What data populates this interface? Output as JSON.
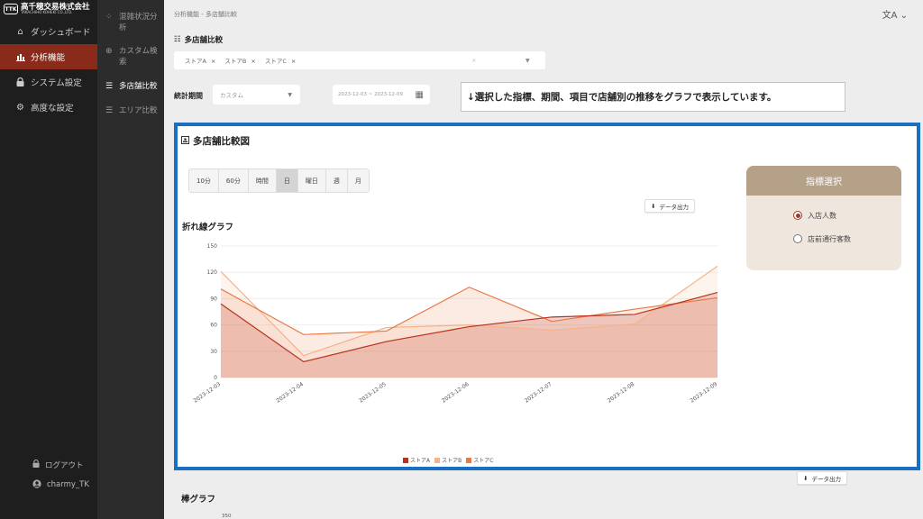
{
  "brand": {
    "logo_text": "TTK",
    "name": "高千穂交易株式会社",
    "sub": "TAKACHIHO KOHEKI CO.,LTD."
  },
  "sidebar": {
    "items": [
      {
        "label": "ダッシュボード",
        "icon": "home-icon"
      },
      {
        "label": "分析機能",
        "icon": "bar-chart-icon",
        "active": true
      },
      {
        "label": "システム設定",
        "icon": "lock-icon"
      },
      {
        "label": "高度な設定",
        "icon": "settings-icon"
      }
    ],
    "logout_label": "ログアウト",
    "user_label": "charmy_TK"
  },
  "subnav": {
    "items": [
      {
        "label": "混雑状況分析",
        "icon": "dots-icon"
      },
      {
        "label": "カスタム検索",
        "icon": "custom-search-icon"
      },
      {
        "label": "多店舗比較",
        "icon": "database-icon",
        "active": true
      },
      {
        "label": "エリア比較",
        "icon": "database-icon"
      }
    ]
  },
  "header": {
    "breadcrumb": "分析機能 - 多店舗比較",
    "language_icon": "translate-icon"
  },
  "filters": {
    "section_title": "多店舗比較",
    "stores": [
      "ストアA",
      "ストアB",
      "ストアC"
    ],
    "chip_remove": "×",
    "clear_all": "×",
    "period_label": "統計期間",
    "period_value": "カスタム",
    "date_range": "2023-12-03 ~ 2023-12-09"
  },
  "callout": "↓選択した指標、期間、項目で店舗別の推移をグラフで表示しています。",
  "card": {
    "title": "多店舗比較図",
    "granularity": [
      "10分",
      "60分",
      "時間",
      "日",
      "曜日",
      "週",
      "月"
    ],
    "granularity_selected": "日",
    "export_label": "データ出力",
    "line_title": "折れ線グラフ",
    "indicator": {
      "title": "指標選択",
      "options": [
        {
          "label": "入店人数",
          "checked": true
        },
        {
          "label": "店前通行客数",
          "checked": false
        }
      ]
    }
  },
  "chart_data": {
    "type": "area",
    "categories": [
      "2023-12-03",
      "2023-12-04",
      "2023-12-05",
      "2023-12-06",
      "2023-12-07",
      "2023-12-08",
      "2023-12-09"
    ],
    "series": [
      {
        "name": "ストアA",
        "values": [
          84,
          18,
          41,
          58,
          69,
          72,
          97
        ]
      },
      {
        "name": "ストアB",
        "values": [
          121,
          25,
          57,
          60,
          54,
          61,
          127
        ]
      },
      {
        "name": "ストアC",
        "values": [
          101,
          49,
          53,
          103,
          64,
          78,
          91
        ]
      }
    ],
    "y_ticks": [
      0,
      30,
      60,
      90,
      120,
      150
    ],
    "ylim": [
      0,
      150
    ],
    "colors": [
      "#b8321f",
      "#f4b38a",
      "#ea7a45"
    ],
    "grid": true,
    "legend_position": "bottom"
  },
  "bar_section": {
    "export_label": "データ出力",
    "title": "棒グラフ",
    "first_tick": "350"
  }
}
